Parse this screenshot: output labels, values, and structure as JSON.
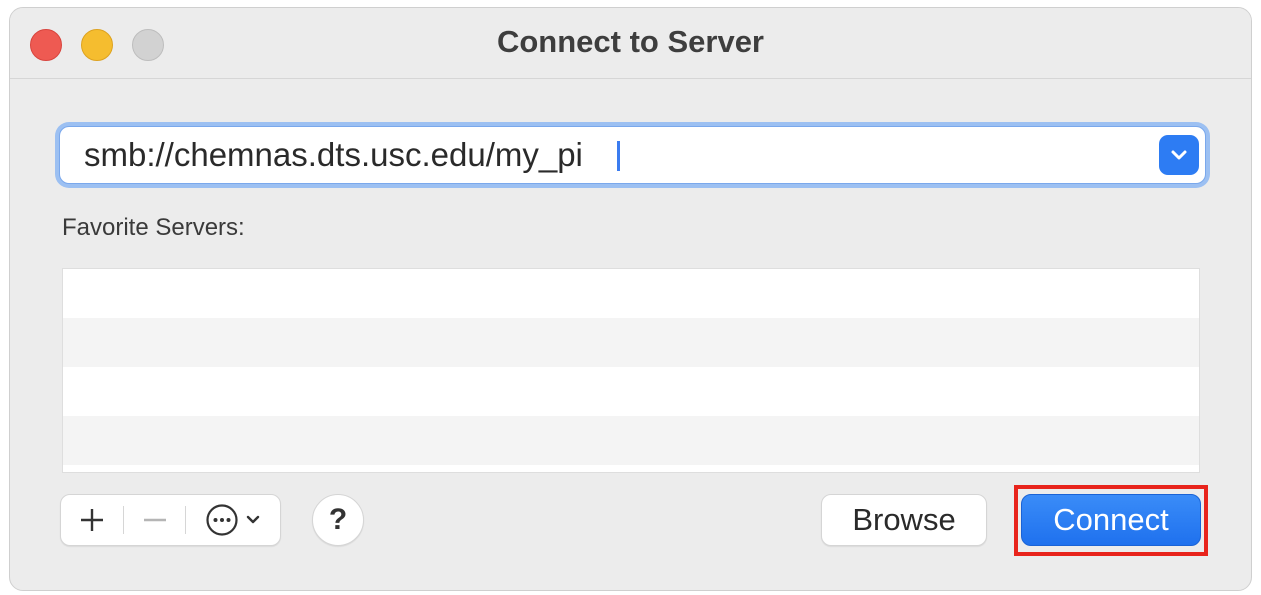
{
  "window": {
    "title": "Connect to Server"
  },
  "traffic_lights": {
    "close": "close-window-button",
    "minimize": "minimize-window-button",
    "zoom": "zoom-window-button"
  },
  "address": {
    "value": "smb://chemnas.dts.usc.edu/my_pi",
    "dropdown_icon": "chevron-down-icon"
  },
  "favorites": {
    "label": "Favorite Servers:",
    "rows": [
      "",
      "",
      "",
      ""
    ]
  },
  "toolbar": {
    "add_icon": "plus-icon",
    "remove_icon": "minus-icon",
    "more_icon": "ellipsis-circle-icon",
    "help_label": "?",
    "browse_label": "Browse",
    "connect_label": "Connect"
  },
  "colors": {
    "accent": "#2d7cf3",
    "highlight": "#e8241c",
    "close": "#ee5a52",
    "minimize": "#f5bd2f",
    "zoom_disabled": "#d2d2d2"
  }
}
